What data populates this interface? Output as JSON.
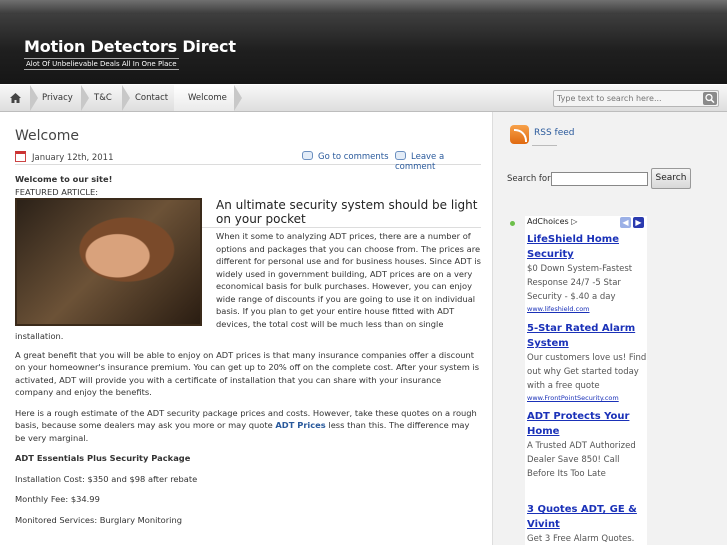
{
  "header": {
    "site_title": "Motion Detectors Direct",
    "tagline": "Alot Of Unbelievable Deals All In One Place"
  },
  "nav": {
    "items": [
      {
        "label": "Privacy"
      },
      {
        "label": "T&C"
      },
      {
        "label": "Contact"
      },
      {
        "label": "Welcome"
      }
    ],
    "search_placeholder": "Type text to search here..."
  },
  "post": {
    "title": "Welcome",
    "date": "January 12th, 2011",
    "comments_link": "Go to comments",
    "leave_comment": "Leave a comment",
    "welcome": "Welcome to our site!",
    "featured_label": "FEATURED ARTICLE:",
    "featured_title": "An ultimate security system should be light on your pocket",
    "p1": "When it some to analyzing ADT prices, there are a number of options and packages that you can choose from. The prices are different for personal use and for business houses. Since ADT is widely used in government building, ADT prices are on a very economical basis for bulk purchases. However, you can enjoy wide range of discounts if you are going to use it on individual basis. If you plan to get your entire house fitted with ADT devices, the total cost will be much less than on single installation.",
    "p2": "A great benefit that you will be able to enjoy on ADT prices is that many insurance companies offer a discount on your homeowner's insurance premium. You can get up to 20% off on the complete cost. After your system is activated, ADT will provide you with a certificate of installation that you can share with your insurance company and enjoy the benefits.",
    "p3_a": "Here is a rough estimate of the ADT security package prices and costs. However, take these quotes on a rough basis, because some dealers may ask you more or may quote ",
    "p3_link": "ADT Prices",
    "p3_b": " less than this. The difference may be very marginal.",
    "package_title": "ADT Essentials Plus Security Package",
    "installation": "Installation Cost: $350 and $98 after rebate",
    "monthly": "Monthly Fee: $34.99",
    "monitored": "Monitored Services: Burglary Monitoring"
  },
  "sidebar": {
    "rss": "RSS feed",
    "search_label": "Search for:",
    "search_button": "Search",
    "ad_choices": "AdChoices ▷",
    "ads": [
      {
        "title": "LifeShield Home Security",
        "text": "$0 Down System-Fastest Response 24/7 -5 Star Security - $.40 a day",
        "url": "www.lifeshield.com"
      },
      {
        "title": "5-Star Rated Alarm System",
        "text": "Our customers love us! Find out why Get started today with a free quote",
        "url": "www.FrontPointSecurity.com"
      },
      {
        "title": "ADT Protects Your Home",
        "text": "A Trusted ADT Authorized Dealer Save 850! Call Before Its Too Late",
        "url": ""
      },
      {
        "title": "3 Quotes ADT, GE & Vivint",
        "text": "Get 3 Free Alarm Quotes.",
        "url": ""
      }
    ]
  }
}
